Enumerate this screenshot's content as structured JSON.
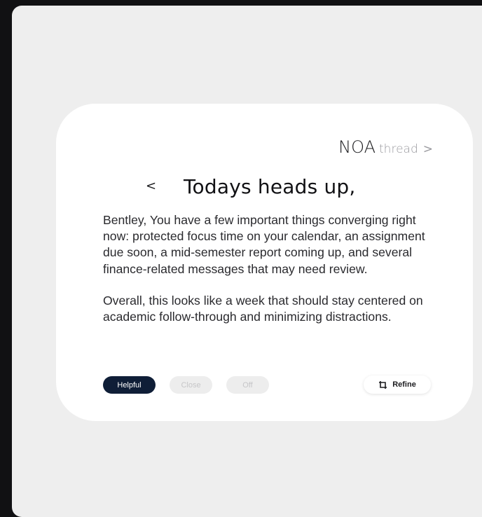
{
  "brand": {
    "logo": "NOA",
    "product": "thread",
    "chevron": ">"
  },
  "header": {
    "back_glyph": "<",
    "title": "Todays heads up,"
  },
  "message": {
    "paragraphs": [
      "Bentley, You have a few important things converging right now: protected focus time on your calendar, an assignment due soon, a mid-semester report coming up, and several finance-related messages that may need review.",
      "Overall, this looks like a week that should stay centered on academic follow-through and minimizing distractions."
    ]
  },
  "actions": {
    "helpful_label": "Helpful",
    "close_label": "Close",
    "off_label": "Off",
    "refine_label": "Refine",
    "refine_icon": "crop-icon"
  },
  "colors": {
    "primary": "#0f1e37",
    "card": "#ffffff",
    "panel": "#eeeeee",
    "backdrop": "#111113"
  }
}
